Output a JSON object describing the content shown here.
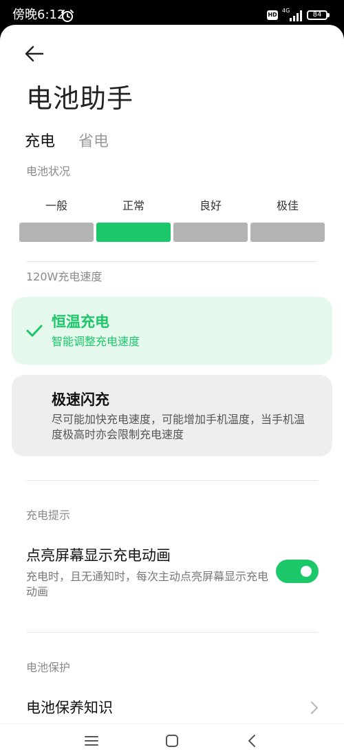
{
  "status_bar": {
    "time": "傍晚6:12",
    "network": "4G",
    "battery": "84",
    "hd": "HD"
  },
  "header": {
    "title": "电池助手"
  },
  "tabs": [
    {
      "label": "充电",
      "active": true
    },
    {
      "label": "省电",
      "active": false
    }
  ],
  "battery_status": {
    "section_label": "电池状况",
    "levels": [
      {
        "label": "一般",
        "active": false
      },
      {
        "label": "正常",
        "active": true
      },
      {
        "label": "良好",
        "active": false
      },
      {
        "label": "极佳",
        "active": false
      }
    ]
  },
  "charging_speed": {
    "section_label": "120W充电速度",
    "options": [
      {
        "title": "恒温充电",
        "desc": "智能调整充电速度",
        "selected": true
      },
      {
        "title": "极速闪充",
        "desc": "尽可能加快充电速度，可能增加手机温度，当手机温度极高时亦会限制充电速度",
        "selected": false
      }
    ]
  },
  "charging_tips": {
    "section_label": "充电提示",
    "title": "点亮屏幕显示充电动画",
    "desc": "充电时，且无通知时，每次主动点亮屏幕显示充电动画",
    "enabled": true
  },
  "battery_protection": {
    "section_label": "电池保护",
    "item": "电池保养知识"
  },
  "colors": {
    "accent": "#1cc76a",
    "active_card_bg": "#e4f8ec",
    "inactive_bar": "#b3b3b3"
  },
  "icons": {
    "back": "back-arrow-icon",
    "check": "check-icon",
    "chevron": "chevron-right-icon",
    "nav": [
      "menu-icon",
      "home-icon",
      "back-triangle-icon"
    ]
  }
}
